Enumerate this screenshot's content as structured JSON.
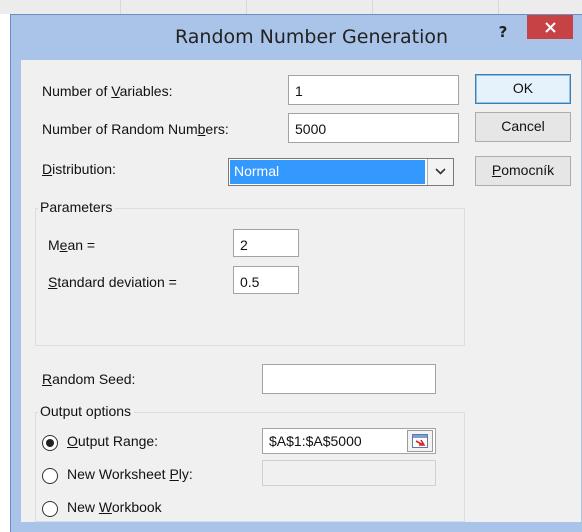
{
  "dialog": {
    "title": "Random Number Generation",
    "help_label": "?"
  },
  "fields": {
    "num_variables_label_pre": "Number of ",
    "num_variables_label_key": "V",
    "num_variables_label_post": "ariables:",
    "num_variables_value": "1",
    "num_random_label_pre": "Number of Random Num",
    "num_random_label_key": "b",
    "num_random_label_post": "ers:",
    "num_random_value": "5000",
    "distribution_label_key": "D",
    "distribution_label_post": "istribution:",
    "distribution_value": "Normal"
  },
  "buttons": {
    "ok": "OK",
    "cancel": "Cancel",
    "help_key": "P",
    "help_post": "omocník"
  },
  "parameters": {
    "title": "Parameters",
    "mean_label_pre": "M",
    "mean_label_key": "e",
    "mean_label_post": "an =",
    "mean_value": "2",
    "std_label_key": "S",
    "std_label_post": "tandard deviation =",
    "std_value": "0.5"
  },
  "seed": {
    "label_key": "R",
    "label_post": "andom Seed:",
    "value": ""
  },
  "output": {
    "title": "Output options",
    "range_label_key": "O",
    "range_label_post": "utput Range:",
    "range_value": "$A$1:$A$5000",
    "worksheet_label_pre": "New Worksheet ",
    "worksheet_label_key": "P",
    "worksheet_label_post": "ly:",
    "workbook_label_pre": "New ",
    "workbook_label_key": "W",
    "workbook_label_post": "orkbook",
    "selected": "Output Range"
  },
  "colors": {
    "title_bar": "#a9c4e8",
    "close_button": "#c74244",
    "selection": "#3399ff"
  }
}
